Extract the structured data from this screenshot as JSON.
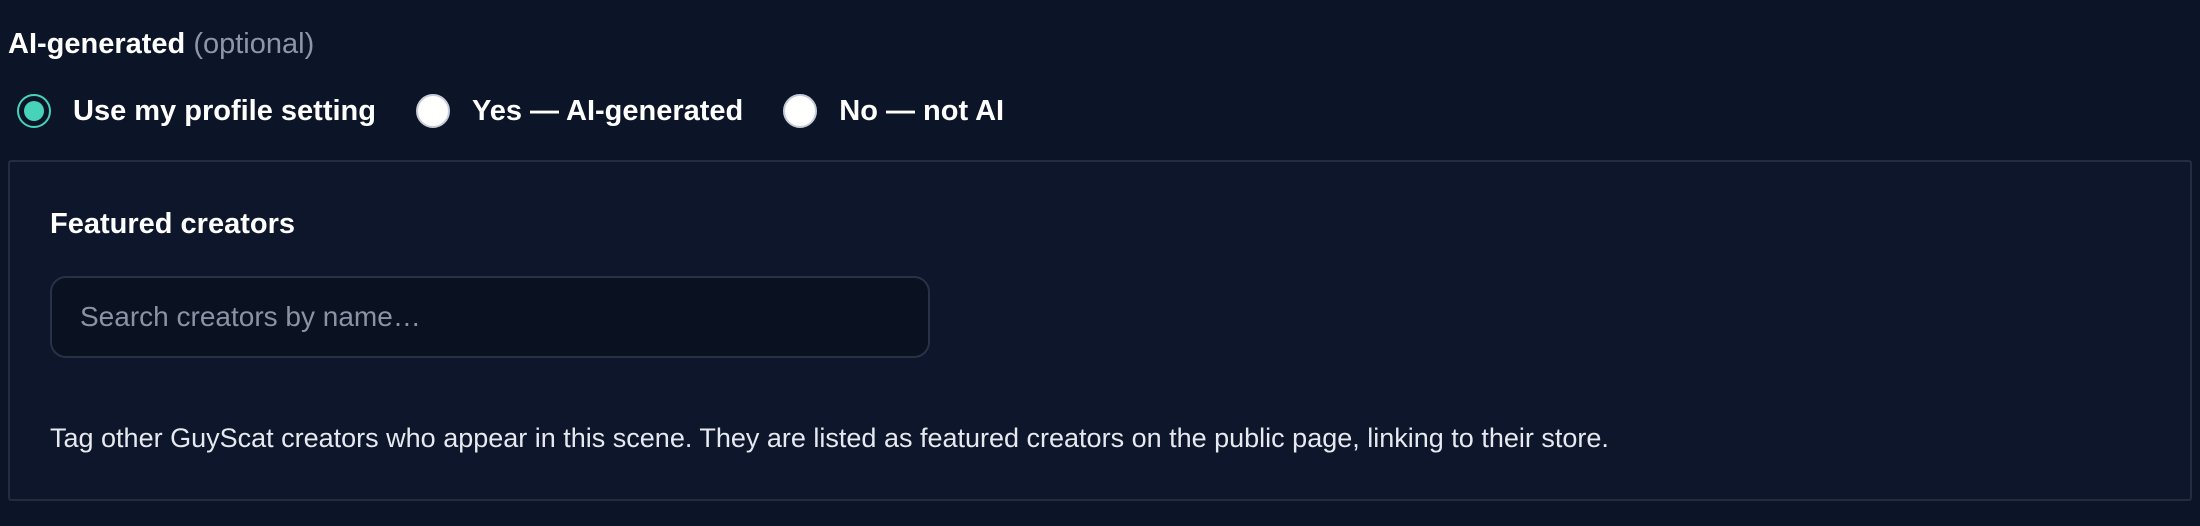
{
  "ai_generated": {
    "label": "AI-generated",
    "optional_hint": "(optional)",
    "options": [
      {
        "label": "Use my profile setting",
        "checked": true
      },
      {
        "label": "Yes — AI-generated",
        "checked": false
      },
      {
        "label": "No — not AI",
        "checked": false
      }
    ],
    "accent_color": "#46d3b9"
  },
  "featured_creators": {
    "title": "Featured creators",
    "search": {
      "value": "",
      "placeholder": "Search creators by name…"
    },
    "help_text": "Tag other GuyScat creators who appear in this scene. They are listed as featured creators on the public page, linking to their store."
  }
}
